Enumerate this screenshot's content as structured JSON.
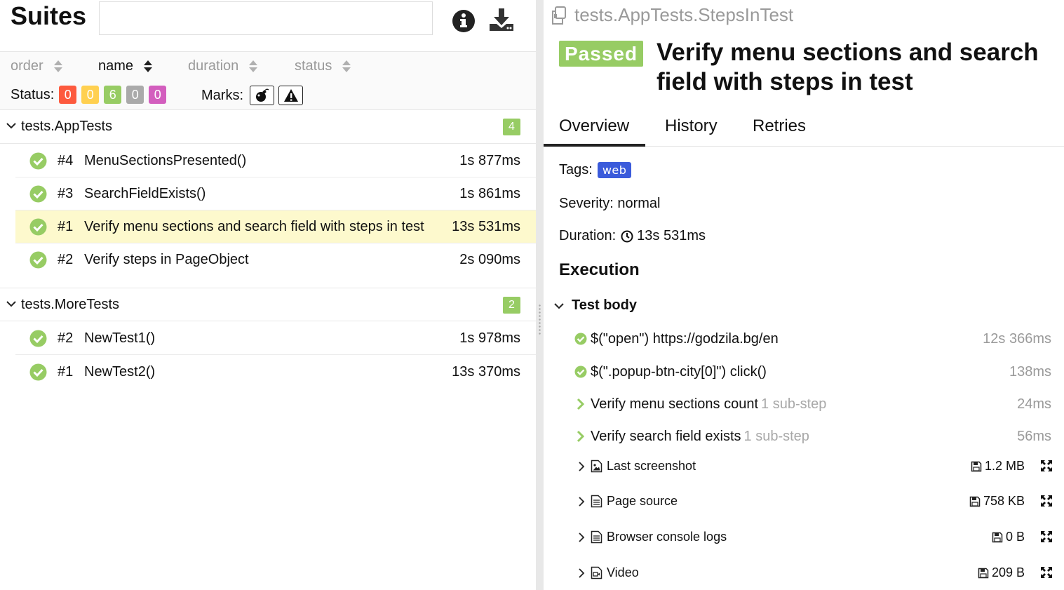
{
  "suites": {
    "title": "Suites",
    "search_placeholder": "",
    "icons": {
      "info": "info-circle-icon",
      "download": "download-icon"
    }
  },
  "sort": {
    "columns": [
      {
        "label": "order",
        "active": false
      },
      {
        "label": "name",
        "active": true
      },
      {
        "label": "duration",
        "active": false
      },
      {
        "label": "status",
        "active": false
      }
    ]
  },
  "filters": {
    "status_label": "Status:",
    "statuses": [
      {
        "name": "failed",
        "count": "0",
        "color": "#fd5a3e"
      },
      {
        "name": "broken",
        "count": "0",
        "color": "#ffd050"
      },
      {
        "name": "passed",
        "count": "6",
        "color": "#97cc64"
      },
      {
        "name": "skipped",
        "count": "0",
        "color": "#aaaaaa"
      },
      {
        "name": "unknown",
        "count": "0",
        "color": "#d35ebe"
      }
    ],
    "marks_label": "Marks:",
    "marks": [
      "bomb-icon",
      "warning-icon"
    ]
  },
  "groups": [
    {
      "name": "tests.AppTests",
      "count": "4",
      "tests": [
        {
          "num": "#4",
          "name": "MenuSectionsPresented()",
          "duration": "1s 877ms",
          "selected": false
        },
        {
          "num": "#3",
          "name": "SearchFieldExists()",
          "duration": "1s 861ms",
          "selected": false
        },
        {
          "num": "#1",
          "name": "Verify menu sections and search field with steps in test",
          "duration": "13s 531ms",
          "selected": true
        },
        {
          "num": "#2",
          "name": "Verify steps in PageObject",
          "duration": "2s 090ms",
          "selected": false
        }
      ]
    },
    {
      "name": "tests.MoreTests",
      "count": "2",
      "tests": [
        {
          "num": "#2",
          "name": "NewTest1()",
          "duration": "1s 978ms",
          "selected": false
        },
        {
          "num": "#1",
          "name": "NewTest2()",
          "duration": "13s 370ms",
          "selected": false
        }
      ]
    }
  ],
  "detail": {
    "path": "tests.AppTests.StepsInTest",
    "status": "Passed",
    "title": "Verify menu sections and search field with steps in test",
    "tabs": [
      "Overview",
      "History",
      "Retries"
    ],
    "active_tab": "Overview",
    "tags_label": "Tags:",
    "tags": [
      "web"
    ],
    "severity": "Severity: normal",
    "duration_label": "Duration:",
    "duration": "13s 531ms",
    "execution_title": "Execution",
    "test_body_label": "Test body",
    "steps": [
      {
        "icon": "check-circle-icon",
        "text": "$(\"open\") https://godzila.bg/en",
        "sub": "",
        "duration": "12s 366ms"
      },
      {
        "icon": "check-circle-icon",
        "text": "$(\".popup-btn-city[0]\") click()",
        "sub": "",
        "duration": "138ms"
      },
      {
        "icon": "chevron-right-icon",
        "text": "Verify menu sections count",
        "sub": "1 sub-step",
        "duration": "24ms"
      },
      {
        "icon": "chevron-right-icon",
        "text": "Verify search field exists",
        "sub": "1 sub-step",
        "duration": "56ms"
      }
    ],
    "attachments": [
      {
        "icon": "image-file-icon",
        "name": "Last screenshot",
        "size": "1.2 MB"
      },
      {
        "icon": "text-file-icon",
        "name": "Page source",
        "size": "758 KB"
      },
      {
        "icon": "text-file-icon",
        "name": "Browser console logs",
        "size": "0 B"
      },
      {
        "icon": "video-file-icon",
        "name": "Video",
        "size": "209 B"
      }
    ]
  },
  "colors": {
    "passed": "#97cc64",
    "selected_row": "#fdf9cd",
    "tag": "#3b5bdb"
  }
}
